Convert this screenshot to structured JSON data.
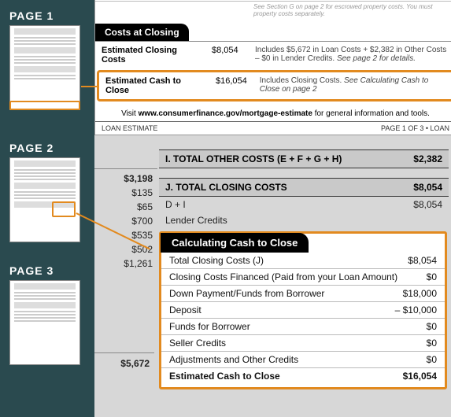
{
  "sidebar": {
    "p1": "PAGE 1",
    "p2": "PAGE 2",
    "p3": "PAGE 3"
  },
  "page1": {
    "top_note": "See Section G on page 2 for escrowed property costs. You must property costs separately.",
    "tab": "Costs at Closing",
    "row1": {
      "label": "Estimated Closing Costs",
      "value": "$8,054",
      "note_a": "Includes $5,672 in Loan Costs + $2,382 in Other Costs – $0 in Lender Credits.",
      "note_b": "See page 2 for details."
    },
    "row2": {
      "label": "Estimated Cash to Close",
      "value": "$16,054",
      "note_a": "Includes Closing Costs.",
      "note_b": "See Calculating Cash to Close on page 2"
    },
    "visit_pre": "Visit ",
    "visit_link": "www.consumerfinance.gov/mortgage-estimate",
    "visit_post": " for general information and tools.",
    "foot_left": "LOAN ESTIMATE",
    "foot_right": "PAGE 1 OF 3 • LOAN"
  },
  "page2": {
    "numcol": [
      "$3,198",
      "$135",
      "$65",
      "$700",
      "$535",
      "$502",
      "$1,261"
    ],
    "headI": {
      "label": "I.  TOTAL OTHER COSTS (E + F + G + H)",
      "value": "$2,382"
    },
    "headJ": {
      "label": "J.  TOTAL CLOSING COSTS",
      "value": "$8,054"
    },
    "rowDI": {
      "label": "D + I",
      "value": "$8,054"
    },
    "lender": "Lender Credits",
    "bottomnum": "$5,672"
  },
  "calc": {
    "tab": "Calculating Cash to Close",
    "rows": [
      {
        "label": "Total Closing Costs (J)",
        "value": "$8,054"
      },
      {
        "label": "Closing Costs Financed (Paid from your Loan Amount)",
        "value": "$0"
      },
      {
        "label": "Down Payment/Funds from Borrower",
        "value": "$18,000"
      },
      {
        "label": "Deposit",
        "value": "– $10,000"
      },
      {
        "label": "Funds for Borrower",
        "value": "$0"
      },
      {
        "label": "Seller Credits",
        "value": "$0"
      },
      {
        "label": "Adjustments and Other Credits",
        "value": "$0"
      },
      {
        "label": "Estimated Cash to Close",
        "value": "$16,054"
      }
    ]
  }
}
